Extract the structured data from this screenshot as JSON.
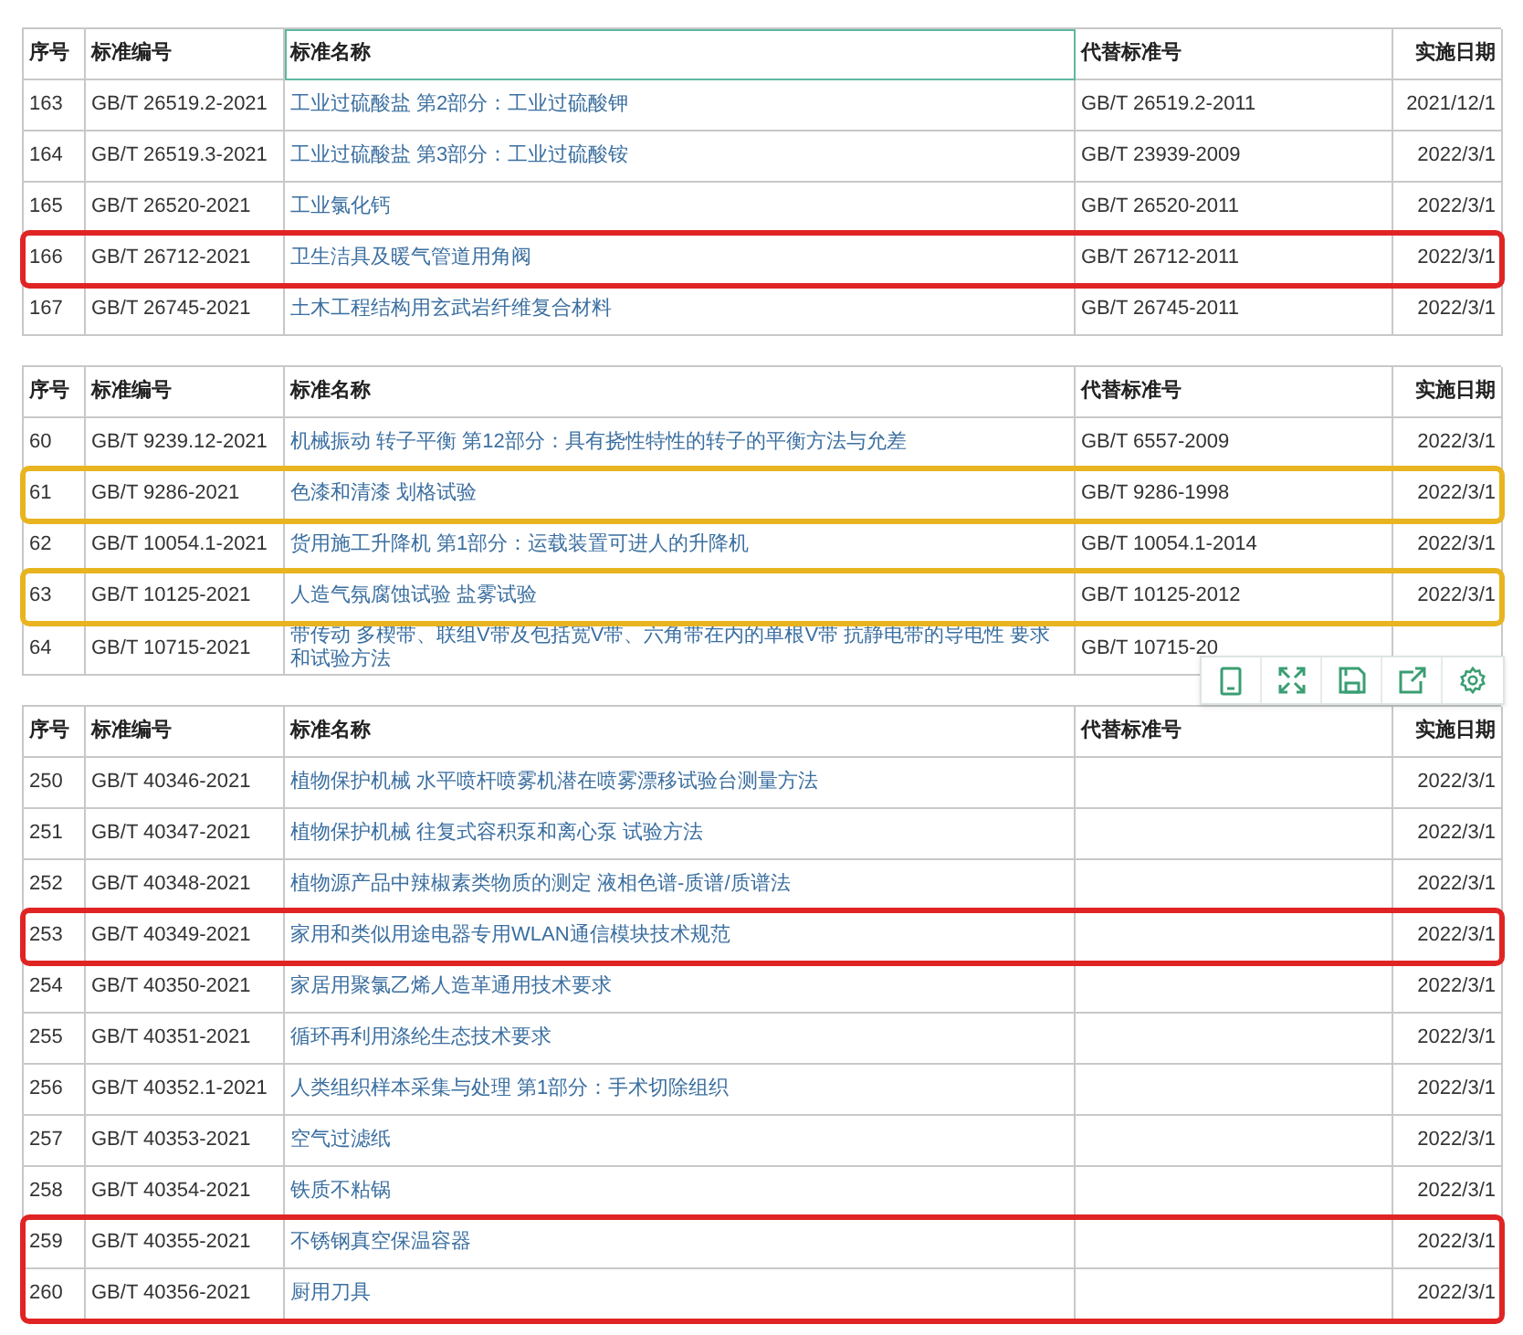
{
  "tables": [
    {
      "color": "#e02424",
      "columns": [
        {
          "label": "序号",
          "focused": false
        },
        {
          "label": "标准编号",
          "focused": false
        },
        {
          "label": "标准名称",
          "focused": true
        },
        {
          "label": "代替标准号",
          "focused": false
        },
        {
          "label": "实施日期",
          "focused": false
        }
      ],
      "rows": [
        {
          "cells": [
            "163",
            "GB/T 26519.2-2021",
            "工业过硫酸盐 第2部分：工业过硫酸钾",
            "GB/T 26519.2-2011",
            "2021/12/1"
          ],
          "highlighted": false
        },
        {
          "cells": [
            "164",
            "GB/T 26519.3-2021",
            "工业过硫酸盐 第3部分：工业过硫酸铵",
            "GB/T 23939-2009",
            "2022/3/1"
          ],
          "highlighted": false
        },
        {
          "cells": [
            "165",
            "GB/T 26520-2021",
            "工业氯化钙",
            "GB/T 26520-2011",
            "2022/3/1"
          ],
          "highlighted": false
        },
        {
          "cells": [
            "166",
            "GB/T 26712-2021",
            "卫生洁具及暖气管道用角阀",
            "GB/T 26712-2011",
            "2022/3/1"
          ],
          "highlighted": true
        },
        {
          "cells": [
            "167",
            "GB/T 26745-2021",
            "土木工程结构用玄武岩纤维复合材料",
            "GB/T 26745-2011",
            "2022/3/1"
          ],
          "highlighted": false
        }
      ]
    },
    {
      "color": "#e8b420",
      "columns": [
        {
          "label": "序号",
          "focused": false
        },
        {
          "label": "标准编号",
          "focused": false
        },
        {
          "label": "标准名称",
          "focused": false
        },
        {
          "label": "代替标准号",
          "focused": false
        },
        {
          "label": "实施日期",
          "focused": false
        }
      ],
      "rows": [
        {
          "cells": [
            "60",
            "GB/T 9239.12-2021",
            "机械振动 转子平衡 第12部分：具有挠性特性的转子的平衡方法与允差",
            "GB/T 6557-2009",
            "2022/3/1"
          ],
          "highlighted": false
        },
        {
          "cells": [
            "61",
            "GB/T 9286-2021",
            "色漆和清漆 划格试验",
            "GB/T 9286-1998",
            "2022/3/1"
          ],
          "highlighted": true
        },
        {
          "cells": [
            "62",
            "GB/T 10054.1-2021",
            "货用施工升降机 第1部分：运载装置可进人的升降机",
            "GB/T 10054.1-2014",
            "2022/3/1"
          ],
          "highlighted": false
        },
        {
          "cells": [
            "63",
            "GB/T 10125-2021",
            "人造气氛腐蚀试验 盐雾试验",
            "GB/T 10125-2012",
            "2022/3/1"
          ],
          "highlighted": true
        },
        {
          "cells": [
            "64",
            "GB/T 10715-2021",
            "带传动 多楔带、联组V带及包括宽V带、六角带在内的单根V带 抗静电带的导电性 要求和试验方法",
            "GB/T 10715-20"
          ],
          "highlighted": false
        }
      ]
    },
    {
      "color": "#e02424",
      "columns": [
        {
          "label": "序号",
          "focused": false
        },
        {
          "label": "标准编号",
          "focused": false
        },
        {
          "label": "标准名称",
          "focused": false
        },
        {
          "label": "代替标准号",
          "focused": false
        },
        {
          "label": "实施日期",
          "focused": false
        }
      ],
      "rows": [
        {
          "cells": [
            "250",
            "GB/T 40346-2021",
            "植物保护机械 水平喷杆喷雾机潜在喷雾漂移试验台测量方法",
            "",
            "2022/3/1"
          ],
          "highlighted": false
        },
        {
          "cells": [
            "251",
            "GB/T 40347-2021",
            "植物保护机械 往复式容积泵和离心泵 试验方法",
            "",
            "2022/3/1"
          ],
          "highlighted": false
        },
        {
          "cells": [
            "252",
            "GB/T 40348-2021",
            "植物源产品中辣椒素类物质的测定 液相色谱-质谱/质谱法",
            "",
            "2022/3/1"
          ],
          "highlighted": false
        },
        {
          "cells": [
            "253",
            "GB/T 40349-2021",
            "家用和类似用途电器专用WLAN通信模块技术规范",
            "",
            "2022/3/1"
          ],
          "highlighted": true
        },
        {
          "cells": [
            "254",
            "GB/T 40350-2021",
            "家居用聚氯乙烯人造革通用技术要求",
            "",
            "2022/3/1"
          ],
          "highlighted": false
        },
        {
          "cells": [
            "255",
            "GB/T 40351-2021",
            "循环再利用涤纶生态技术要求",
            "",
            "2022/3/1"
          ],
          "highlighted": false
        },
        {
          "cells": [
            "256",
            "GB/T 40352.1-2021",
            "人类组织样本采集与处理 第1部分：手术切除组织",
            "",
            "2022/3/1"
          ],
          "highlighted": false
        },
        {
          "cells": [
            "257",
            "GB/T 40353-2021",
            "空气过滤纸",
            "",
            "2022/3/1"
          ],
          "highlighted": false
        },
        {
          "cells": [
            "258",
            "GB/T 40354-2021",
            "铁质不粘锅",
            "",
            "2022/3/1"
          ],
          "highlighted": false
        },
        {
          "cells": [
            "259",
            "GB/T 40355-2021",
            "不锈钢真空保温容器",
            "",
            "2022/3/1"
          ],
          "highlighted": true
        },
        {
          "cells": [
            "260",
            "GB/T 40356-2021",
            "厨用刀具",
            "",
            "2022/3/1"
          ],
          "highlighted": true
        }
      ]
    }
  ]
}
